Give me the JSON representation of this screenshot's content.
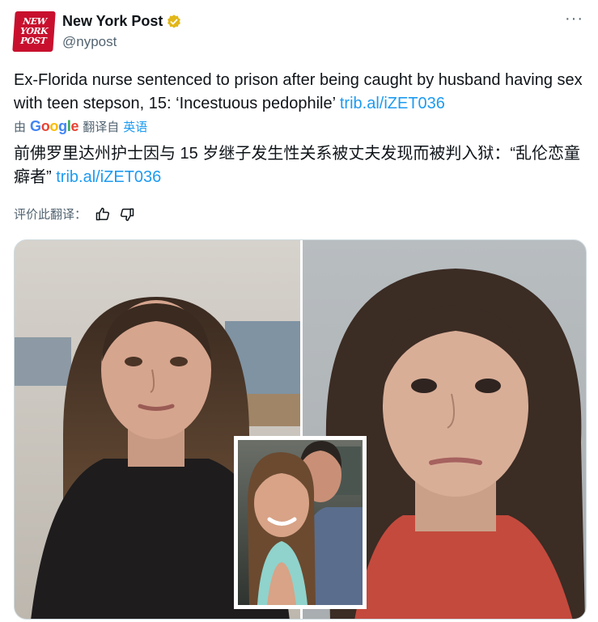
{
  "account": {
    "display_name": "New York Post",
    "handle": "@nypost",
    "avatar_text": [
      "NEW",
      "YORK",
      "POST"
    ],
    "verified_color": "#e2b719"
  },
  "tweet": {
    "text": "Ex-Florida nurse sentenced to prison after being caught by husband having sex with teen stepson, 15: ‘Incestuous pedophile’",
    "link": "trib.al/iZET036"
  },
  "translation": {
    "by_prefix": "由",
    "by_service": "Google",
    "translated_label": "翻译自",
    "source_language": "英语",
    "text": "前佛罗里达州护士因与 15 岁继子发生性关系被丈夫发现而被判入狱：“乱伦恋童癖者”",
    "link": "trib.al/iZET036"
  },
  "rating": {
    "label": "评价此翻译：",
    "thumbs_up_icon": "thumbs-up-icon",
    "thumbs_down_icon": "thumbs-down-icon"
  },
  "more_icon": "more-options-icon",
  "colors": {
    "link": "#1d9bf0",
    "secondary_text": "#536471",
    "brand": "#c8102e"
  }
}
